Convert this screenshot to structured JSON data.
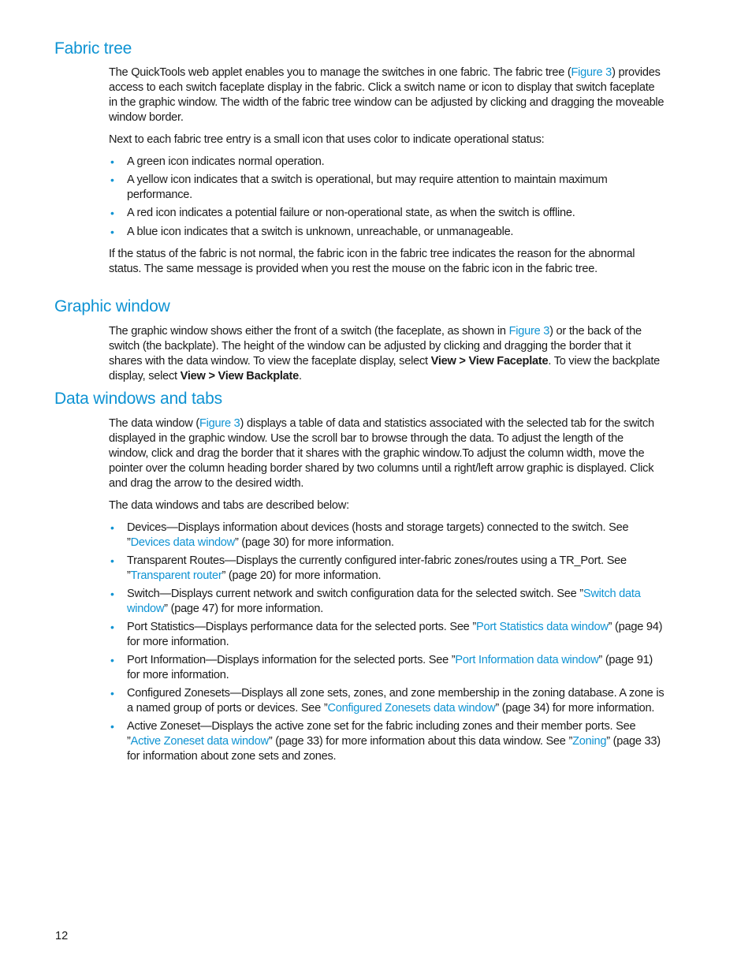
{
  "sections": {
    "fabric_tree": {
      "heading": "Fabric tree",
      "intro": {
        "part1": "The QuickTools web applet enables you to manage the switches in one fabric. The fabric tree (",
        "link": "Figure 3",
        "part2": ") provides access to each switch faceplate display in the fabric. Click a switch name or icon to display that switch faceplate in the graphic window. The width of the fabric tree window can be adjusted by clicking and dragging the moveable window border."
      },
      "status_intro": "Next to each fabric tree entry is a small icon that uses color to indicate operational status:",
      "status_items": [
        "A green icon indicates normal operation.",
        "A yellow icon indicates that a switch is operational, but may require attention to maintain maximum performance.",
        "A red icon indicates a potential failure or non-operational state, as when the switch is offline.",
        "A blue icon indicates that a switch is unknown, unreachable, or unmanageable."
      ],
      "closing": "If the status of the fabric is not normal, the fabric icon in the fabric tree indicates the reason for the abnormal status. The same message is provided when you rest the mouse on the fabric icon in the fabric tree."
    },
    "graphic_window": {
      "heading": "Graphic window",
      "part1": "The graphic window shows either the front of a switch (the faceplate, as shown in ",
      "link": "Figure 3",
      "part2": ") or the back of the switch (the backplate). The height of the window can be adjusted by clicking and dragging the border that it shares with the data window. To view the faceplate display, select ",
      "bold1": "View > View Faceplate",
      "part3": ". To view the backplate display, select ",
      "bold2": "View > View Backplate",
      "part4": "."
    },
    "data_windows": {
      "heading": "Data windows and tabs",
      "intro": {
        "part1": "The data window (",
        "link": "Figure 3",
        "part2": ") displays a table of data and statistics associated with the selected tab for the switch displayed in the graphic window. Use the scroll bar to browse through the data. To adjust the length of the window, click and drag the border that it shares with the graphic window.To adjust the column width, move the pointer over the column heading border shared by two columns until a right/left arrow graphic is displayed. Click and drag the arrow to the desired width."
      },
      "list_intro": "The data windows and tabs are described below:",
      "items": [
        {
          "text": "Devices—Displays information about devices (hosts and storage targets) connected to the switch. See ”",
          "link": "Devices data window",
          "after": "” (page 30) for more information.",
          "link2": "",
          "after2": ""
        },
        {
          "text": "Transparent Routes—Displays the currently configured inter-fabric zones/routes using a TR_Port. See ”",
          "link": "Transparent router",
          "after": "” (page 20) for more information.",
          "link2": "",
          "after2": ""
        },
        {
          "text": "Switch—Displays current network and switch configuration data for the selected switch. See ”",
          "link": "Switch data window",
          "after": "” (page 47) for more information.",
          "link2": "",
          "after2": ""
        },
        {
          "text": "Port Statistics—Displays performance data for the selected ports. See ”",
          "link": "Port Statistics data window",
          "after": "” (page 94) for more information.",
          "link2": "",
          "after2": ""
        },
        {
          "text": "Port Information—Displays information for the selected ports. See ”",
          "link": "Port Information data window",
          "after": "” (page 91) for more information.",
          "link2": "",
          "after2": ""
        },
        {
          "text": "Configured Zonesets—Displays all zone sets, zones, and zone membership in the zoning database. A zone is a named group of ports or devices. See ”",
          "link": "Configured Zonesets data window",
          "after": "” (page 34) for more information.",
          "link2": "",
          "after2": ""
        },
        {
          "text": "Active Zoneset—Displays the active zone set for the fabric including zones and their member ports. See ”",
          "link": "Active Zoneset data window",
          "after": "” (page 33) for more information about this data window. See ”",
          "link2": "Zoning",
          "after2": "” (page 33) for information about zone sets and zones."
        }
      ]
    }
  },
  "bullet_glyph": "•",
  "page_number": "12",
  "colors": {
    "heading": "#0e93d3",
    "link": "#0e93d3",
    "text": "#1a1a1a"
  }
}
